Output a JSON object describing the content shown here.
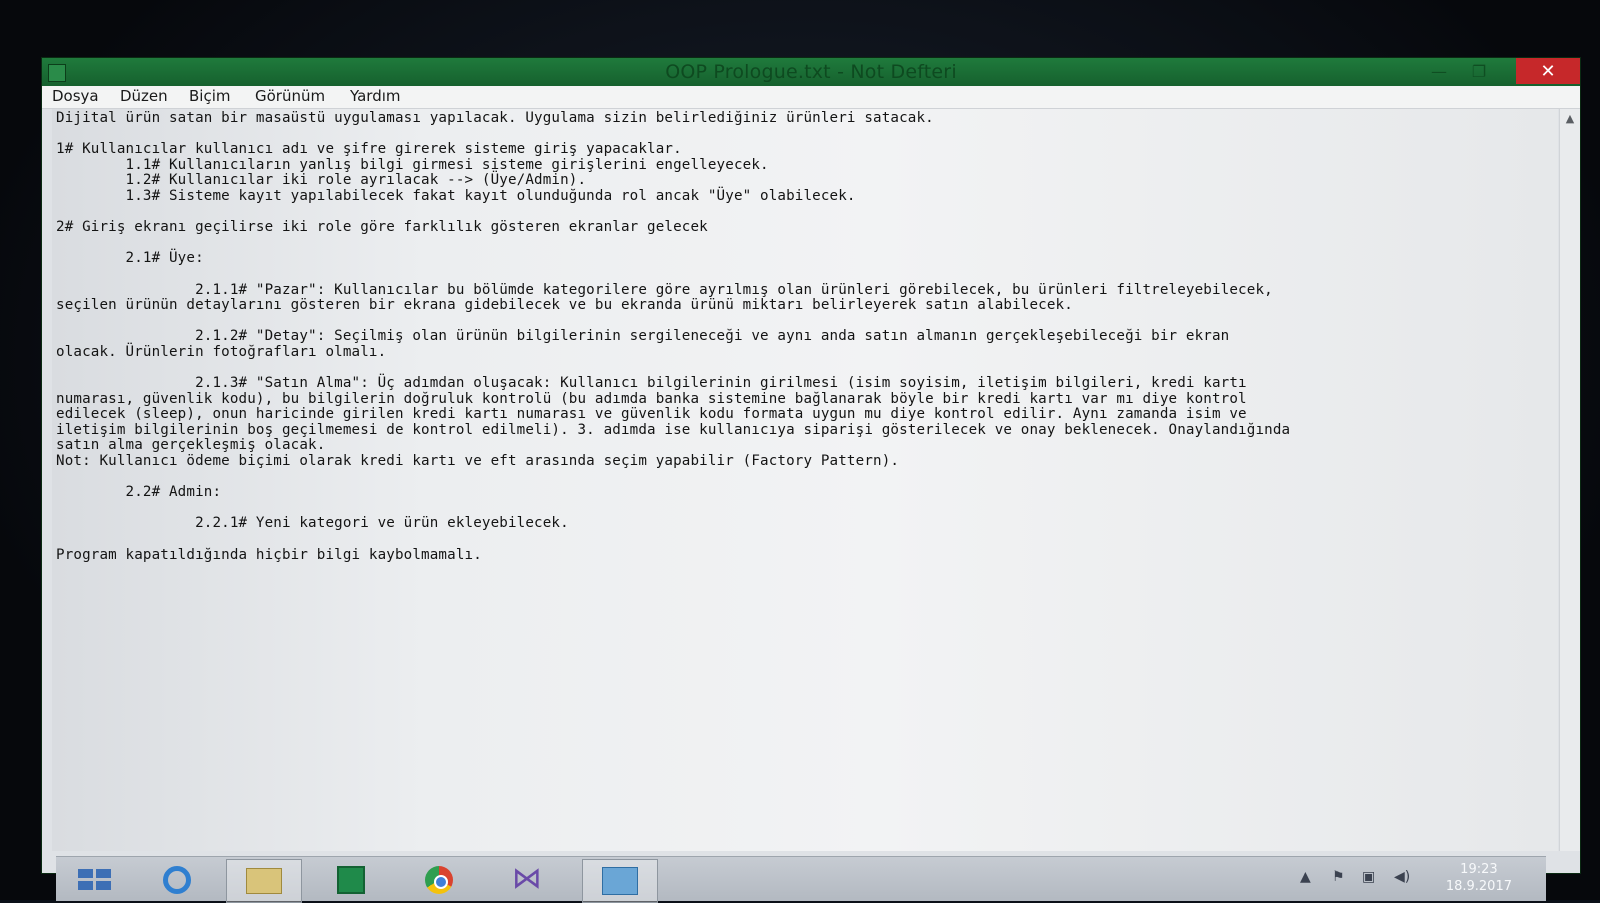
{
  "window": {
    "title": "OOP Prologue.txt - Not Defteri",
    "minimize_glyph": "—",
    "maximize_glyph": "❐",
    "close_glyph": "✕"
  },
  "menu": {
    "items": [
      "Dosya",
      "Düzen",
      "Biçim",
      "Görünüm",
      "Yardım"
    ]
  },
  "document": {
    "text": "Dijital ürün satan bir masaüstü uygulaması yapılacak. Uygulama sizin belirlediğiniz ürünleri satacak.\n\n1# Kullanıcılar kullanıcı adı ve şifre girerek sisteme giriş yapacaklar.\n        1.1# Kullanıcıların yanlış bilgi girmesi sisteme girişlerini engelleyecek.\n        1.2# Kullanıcılar iki role ayrılacak --> (Üye/Admin).\n        1.3# Sisteme kayıt yapılabilecek fakat kayıt olunduğunda rol ancak \"Üye\" olabilecek.\n\n2# Giriş ekranı geçilirse iki role göre farklılık gösteren ekranlar gelecek\n\n        2.1# Üye:\n\n                2.1.1# \"Pazar\": Kullanıcılar bu bölümde kategorilere göre ayrılmış olan ürünleri görebilecek, bu ürünleri filtreleyebilecek,\nseçilen ürünün detaylarını gösteren bir ekrana gidebilecek ve bu ekranda ürünü miktarı belirleyerek satın alabilecek.\n\n                2.1.2# \"Detay\": Seçilmiş olan ürünün bilgilerinin sergileneceği ve aynı anda satın almanın gerçekleşebileceği bir ekran\nolacak. Ürünlerin fotoğrafları olmalı.\n\n                2.1.3# \"Satın Alma\": Üç adımdan oluşacak: Kullanıcı bilgilerinin girilmesi (isim soyisim, iletişim bilgileri, kredi kartı\nnumarası, güvenlik kodu), bu bilgilerin doğruluk kontrolü (bu adımda banka sistemine bağlanarak böyle bir kredi kartı var mı diye kontrol\nedilecek (sleep), onun haricinde girilen kredi kartı numarası ve güvenlik kodu formata uygun mu diye kontrol edilir. Aynı zamanda isim ve\niletişim bilgilerinin boş geçilmemesi de kontrol edilmeli). 3. adımda ise kullanıcıya siparişi gösterilecek ve onay beklenecek. Onaylandığında\nsatın alma gerçekleşmiş olacak.\nNot: Kullanıcı ödeme biçimi olarak kredi kartı ve eft arasında seçim yapabilir (Factory Pattern).\n\n        2.2# Admin:\n\n                2.2.1# Yeni kategori ve ürün ekleyebilecek.\n\nProgram kapatıldığında hiçbir bilgi kaybolmamalı."
  },
  "scrollbar": {
    "up_glyph": "▲"
  },
  "taskbar": {
    "buttons": [
      {
        "name": "start",
        "icon": "windows-logo-icon"
      },
      {
        "name": "internet-explorer",
        "icon": "ie-icon"
      },
      {
        "name": "file-explorer",
        "icon": "folder-icon"
      },
      {
        "name": "store",
        "icon": "store-icon"
      },
      {
        "name": "chrome",
        "icon": "chrome-icon"
      },
      {
        "name": "visual-studio",
        "icon": "visual-studio-icon"
      },
      {
        "name": "notepad",
        "icon": "notepad-icon",
        "active": true
      }
    ],
    "tray": {
      "chevron": "▲",
      "flag": "⚑",
      "network": "▣",
      "volume": "◀)",
      "time": "19:23",
      "date": "18.9.2017"
    }
  },
  "colors": {
    "titlebar": "#1f7a3c",
    "close_button": "#c6282a",
    "taskbar": "#c6cbd2"
  }
}
